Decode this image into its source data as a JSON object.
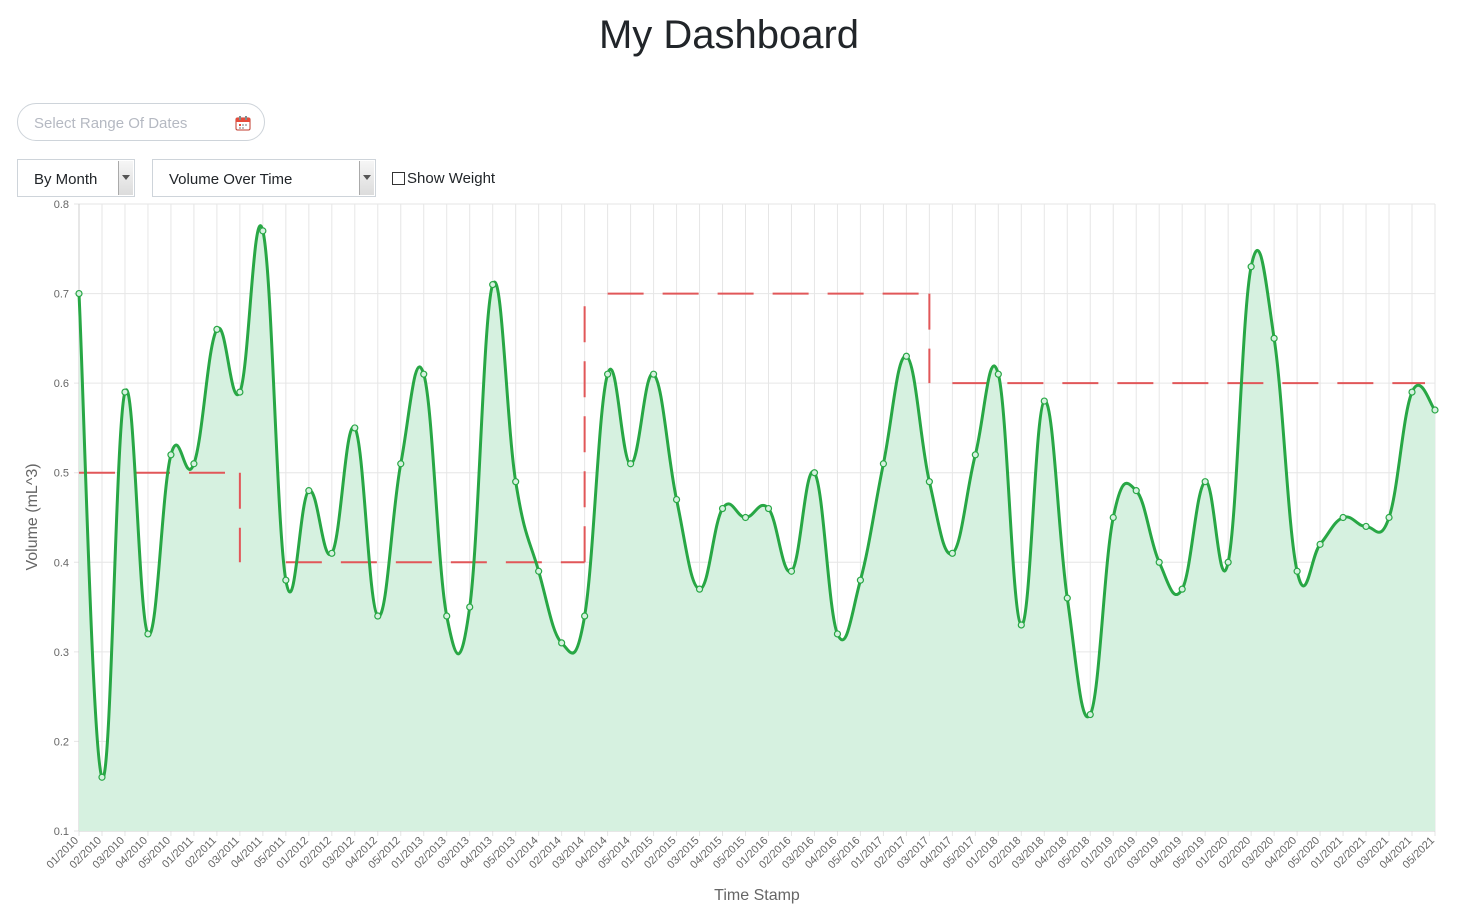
{
  "page": {
    "title": "My Dashboard"
  },
  "controls": {
    "date_range_placeholder": "Select Range Of Dates",
    "date_icon": "calendar-icon",
    "group_by_value": "By Month",
    "metric_value": "Volume Over Time",
    "show_weight_label": "Show Weight",
    "show_weight_checked": false
  },
  "chart_data": {
    "type": "line",
    "title": "",
    "xlabel": "Time Stamp",
    "ylabel": "Volume (mL^3)",
    "ylim": [
      0.1,
      0.8
    ],
    "yticks": [
      0.1,
      0.2,
      0.3,
      0.4,
      0.5,
      0.6,
      0.7,
      0.8
    ],
    "grid": true,
    "legend": "none",
    "categories": [
      "01/2010",
      "02/2010",
      "03/2010",
      "04/2010",
      "05/2010",
      "01/2011",
      "02/2011",
      "03/2011",
      "04/2011",
      "05/2011",
      "01/2012",
      "02/2012",
      "03/2012",
      "04/2012",
      "05/2012",
      "01/2013",
      "02/2013",
      "03/2013",
      "04/2013",
      "05/2013",
      "01/2014",
      "02/2014",
      "03/2014",
      "04/2014",
      "05/2014",
      "01/2015",
      "02/2015",
      "03/2015",
      "04/2015",
      "05/2015",
      "01/2016",
      "02/2016",
      "03/2016",
      "04/2016",
      "05/2016",
      "01/2017",
      "02/2017",
      "03/2017",
      "04/2017",
      "05/2017",
      "01/2018",
      "02/2018",
      "03/2018",
      "04/2018",
      "05/2018",
      "01/2019",
      "02/2019",
      "03/2019",
      "04/2019",
      "05/2019",
      "01/2020",
      "02/2020",
      "03/2020",
      "04/2020",
      "05/2020",
      "01/2021",
      "02/2021",
      "03/2021",
      "04/2021",
      "05/2021"
    ],
    "series": [
      {
        "values": [
          0.7,
          0.16,
          0.59,
          0.32,
          0.52,
          0.51,
          0.66,
          0.59,
          0.77,
          0.38,
          0.48,
          0.41,
          0.55,
          0.34,
          0.51,
          0.61,
          0.34,
          0.35,
          0.71,
          0.49,
          0.39,
          0.31,
          0.34,
          0.61,
          0.51,
          0.61,
          0.47,
          0.37,
          0.46,
          0.45,
          0.46,
          0.39,
          0.5,
          0.32,
          0.38,
          0.51,
          0.63,
          0.49,
          0.41,
          0.52,
          0.61,
          0.33,
          0.58,
          0.36,
          0.23,
          0.45,
          0.48,
          0.4,
          0.37,
          0.49,
          0.4,
          0.73,
          0.65,
          0.39,
          0.42,
          0.45,
          0.44,
          0.45,
          0.59,
          0.57
        ],
        "color": "#28a745",
        "fill": "#d6f1e0",
        "style": "smooth-area"
      },
      {
        "step_ranges": [
          {
            "from": "01/2010",
            "to": "03/2011",
            "value": 0.5
          },
          {
            "from": "05/2011",
            "to": "03/2014",
            "value": 0.4
          },
          {
            "from": "04/2014",
            "to": "03/2017",
            "value": 0.7
          },
          {
            "from": "04/2017",
            "to": "05/2021",
            "value": 0.6
          }
        ],
        "color": "#e15759",
        "style": "dashed-step"
      }
    ]
  }
}
